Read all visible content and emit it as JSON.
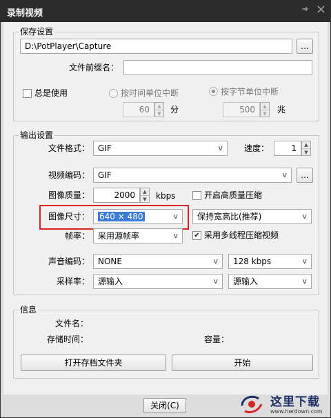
{
  "window": {
    "title": "录制视频"
  },
  "save": {
    "group_title": "保存设置",
    "path": "D:\\PotPlayer\\Capture",
    "browse_label": "...",
    "prefix_label": "文件前缀名：",
    "prefix_value": "",
    "always_use": {
      "label": "总是使用",
      "checked": false
    },
    "by_time": {
      "label": "按时间单位中断",
      "selected": false,
      "value": "60",
      "unit": "分"
    },
    "by_size": {
      "label": "按字节单位中断",
      "selected": true,
      "value": "500",
      "unit": "兆"
    }
  },
  "output": {
    "group_title": "输出设置",
    "format_label": "文件格式：",
    "format_value": "GIF",
    "speed_label": "速度：",
    "speed_value": "1",
    "video_codec_label": "视频编码：",
    "video_codec_value": "GIF",
    "codec_settings_label": "...",
    "quality_label": "图像质量：",
    "quality_value": "2000",
    "quality_unit": "kbps",
    "hq_compress": {
      "label": "开启高质量压缩",
      "checked": false
    },
    "size_label": "图像尺寸：",
    "size_value": "640 × 480",
    "aspect_value": "保持宽高比(推荐)",
    "fps_label": "帧率：",
    "fps_value": "采用源帧率",
    "multithread": {
      "label": "采用多线程压缩视频",
      "checked": true
    },
    "audio_codec_label": "声音编码：",
    "audio_codec_value": "NONE",
    "audio_bitrate_value": "128 kbps",
    "sample_rate_label": "采样率：",
    "sample_rate_value": "源输入",
    "channels_value": "源输入"
  },
  "info": {
    "group_title": "信息",
    "filename_label": "文件名：",
    "storage_time_label": "存储时间：",
    "size_label": "容量：",
    "open_folder_label": "打开存档文件夹",
    "start_label": "开始"
  },
  "footer": {
    "close_label": "关闭(C)"
  },
  "watermark": {
    "text": "这里下载",
    "url": "www.herdown.com"
  },
  "colors": {
    "highlight_border": "#d62424",
    "selection": "#3a7bd5",
    "titlebar": "#2b2b2b"
  },
  "icons": {
    "pin": "pin-icon",
    "close": "close-icon",
    "dropdown": "chevron-down-icon",
    "check": "checkmark-icon"
  }
}
